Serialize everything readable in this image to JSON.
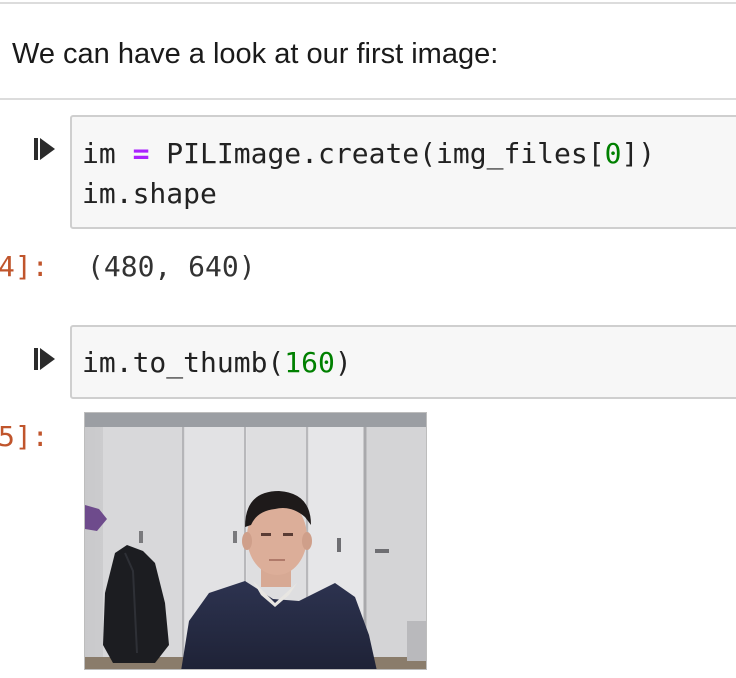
{
  "markdown_cell": {
    "text": "We can have a look at our first image:"
  },
  "cells": [
    {
      "prompt": "4]:",
      "code_lines": [
        [
          {
            "text": "im "
          },
          {
            "text": "=",
            "cls": "tok-op"
          },
          {
            "text": " PILImage.create(img_files["
          },
          {
            "text": "0",
            "cls": "tok-num"
          },
          {
            "text": "])"
          }
        ],
        [
          {
            "text": "im.shape"
          }
        ]
      ],
      "output": "(480, 640)"
    },
    {
      "prompt": "5]:",
      "code_lines": [
        [
          {
            "text": "im.to_thumb("
          },
          {
            "text": "160",
            "cls": "tok-num"
          },
          {
            "text": ")"
          }
        ]
      ],
      "output_image": "thumbnail of a man in a dark sweater in a room with white cabinets"
    }
  ],
  "icons": {
    "run": "run-cell-icon"
  },
  "colors": {
    "prompt": "#c0552c",
    "code_bg": "#f7f7f7",
    "operator": "#aa22ff",
    "number": "#008000"
  }
}
